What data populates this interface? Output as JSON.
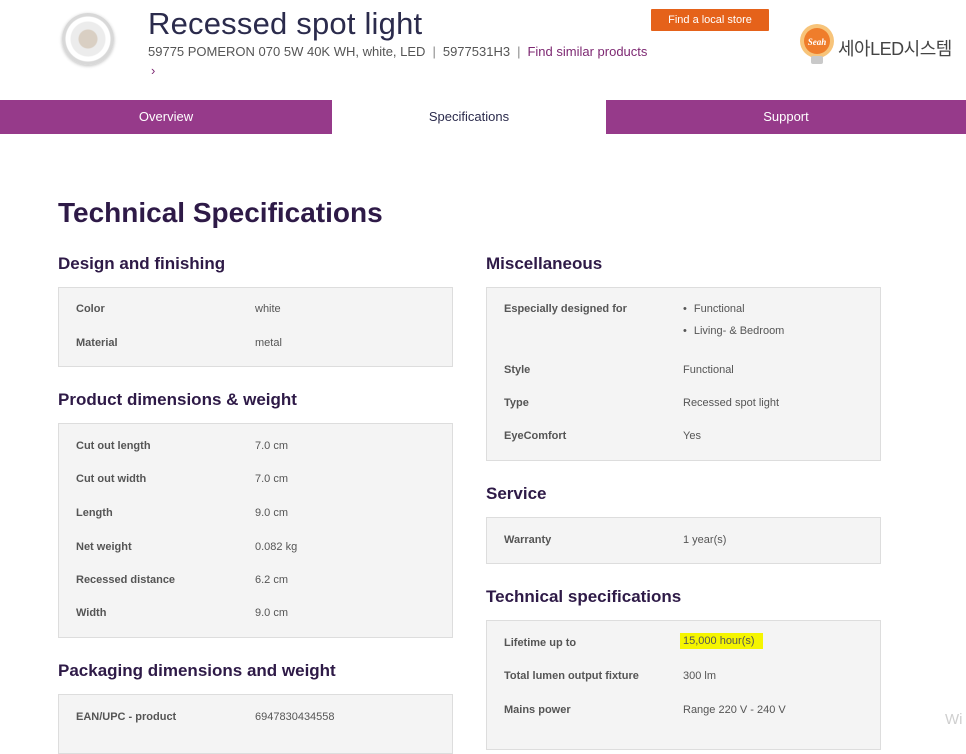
{
  "header": {
    "title": "Recessed spot light",
    "product_name": "59775 POMERON 070 5W 40K WH, white, LED",
    "product_code": "5977531H3",
    "similar_link": "Find similar products",
    "chevron": "›",
    "store_button": "Find a local store",
    "brand_badge": "Seah",
    "brand_name": "세아LED시스템"
  },
  "tabs": [
    {
      "label": "Overview"
    },
    {
      "label": "Specifications"
    },
    {
      "label": "Support"
    }
  ],
  "page_heading": "Technical Specifications",
  "sections": {
    "design": {
      "title": "Design and finishing",
      "rows": [
        {
          "label": "Color",
          "value": "white"
        },
        {
          "label": "Material",
          "value": "metal"
        }
      ]
    },
    "dimensions": {
      "title": "Product dimensions & weight",
      "rows": [
        {
          "label": "Cut out length",
          "value": "7.0  cm"
        },
        {
          "label": "Cut out width",
          "value": "7.0  cm"
        },
        {
          "label": "Length",
          "value": "9.0  cm"
        },
        {
          "label": "Net weight",
          "value": "0.082  kg"
        },
        {
          "label": "Recessed distance",
          "value": "6.2  cm"
        },
        {
          "label": "Width",
          "value": "9.0  cm"
        }
      ]
    },
    "packaging": {
      "title": "Packaging dimensions and weight",
      "rows": [
        {
          "label": "EAN/UPC - product",
          "value": "6947830434558"
        }
      ]
    },
    "misc": {
      "title": "Miscellaneous",
      "designed_for_label": "Especially designed for",
      "designed_for": [
        "Functional",
        "Living- & Bedroom"
      ],
      "rows": [
        {
          "label": "Style",
          "value": "Functional"
        },
        {
          "label": "Type",
          "value": "Recessed spot light"
        },
        {
          "label": "EyeComfort",
          "value": "Yes"
        }
      ]
    },
    "service": {
      "title": "Service",
      "rows": [
        {
          "label": "Warranty",
          "value": "1 year(s)"
        }
      ]
    },
    "tech": {
      "title": "Technical specifications",
      "rows": [
        {
          "label": "Lifetime up to",
          "value": "15,000  hour(s)"
        },
        {
          "label": "Total lumen output fixture",
          "value": "300 lm"
        },
        {
          "label": "Mains power",
          "value": "Range 220 V - 240 V"
        }
      ]
    }
  },
  "watermark": "Wi",
  "colors": {
    "tab_purple": "#963a8a",
    "heading": "#2e1a47",
    "link": "#7d2872",
    "store_orange": "#e5621a",
    "highlight": "#f5f500"
  }
}
